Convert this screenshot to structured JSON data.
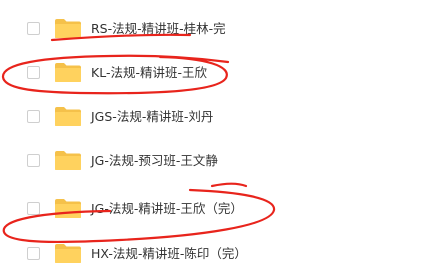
{
  "files": [
    {
      "name": "RS-法规-精讲班-桂林-完"
    },
    {
      "name": "KL-法规-精讲班-王欣"
    },
    {
      "name": "JGS-法规-精讲班-刘丹"
    },
    {
      "name": "JG-法规-预习班-王文静"
    },
    {
      "name": "JG-法规-精讲班-王欣（完）"
    },
    {
      "name": "HX-法规-精讲班-陈印（完）"
    }
  ],
  "colors": {
    "folder": "#FFD25E",
    "folder_tab": "#F5C14A",
    "annotation": "#E8241C"
  },
  "icons": {
    "row_icon": "folder-icon",
    "checkbox": "checkbox-icon"
  }
}
